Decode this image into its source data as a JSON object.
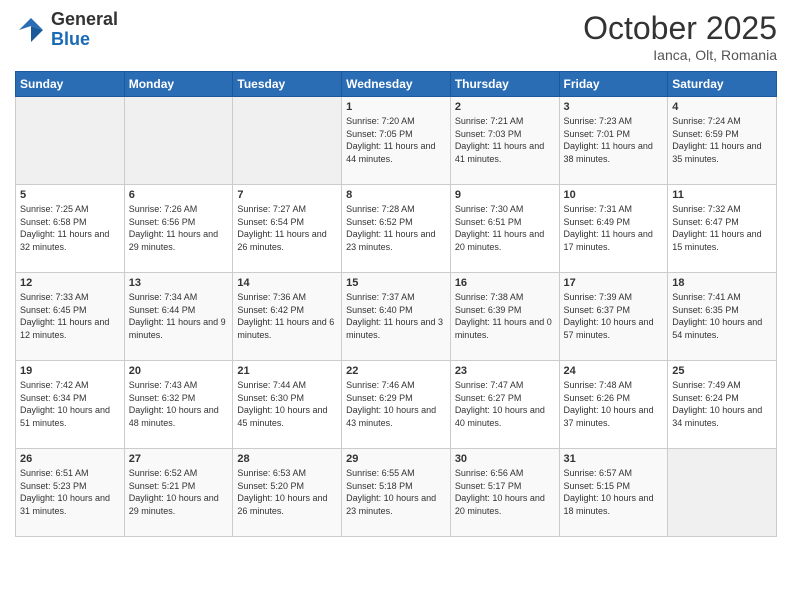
{
  "header": {
    "logo_general": "General",
    "logo_blue": "Blue",
    "month_title": "October 2025",
    "subtitle": "Ianca, Olt, Romania"
  },
  "weekdays": [
    "Sunday",
    "Monday",
    "Tuesday",
    "Wednesday",
    "Thursday",
    "Friday",
    "Saturday"
  ],
  "weeks": [
    [
      {
        "day": "",
        "info": ""
      },
      {
        "day": "",
        "info": ""
      },
      {
        "day": "",
        "info": ""
      },
      {
        "day": "1",
        "info": "Sunrise: 7:20 AM\nSunset: 7:05 PM\nDaylight: 11 hours and 44 minutes."
      },
      {
        "day": "2",
        "info": "Sunrise: 7:21 AM\nSunset: 7:03 PM\nDaylight: 11 hours and 41 minutes."
      },
      {
        "day": "3",
        "info": "Sunrise: 7:23 AM\nSunset: 7:01 PM\nDaylight: 11 hours and 38 minutes."
      },
      {
        "day": "4",
        "info": "Sunrise: 7:24 AM\nSunset: 6:59 PM\nDaylight: 11 hours and 35 minutes."
      }
    ],
    [
      {
        "day": "5",
        "info": "Sunrise: 7:25 AM\nSunset: 6:58 PM\nDaylight: 11 hours and 32 minutes."
      },
      {
        "day": "6",
        "info": "Sunrise: 7:26 AM\nSunset: 6:56 PM\nDaylight: 11 hours and 29 minutes."
      },
      {
        "day": "7",
        "info": "Sunrise: 7:27 AM\nSunset: 6:54 PM\nDaylight: 11 hours and 26 minutes."
      },
      {
        "day": "8",
        "info": "Sunrise: 7:28 AM\nSunset: 6:52 PM\nDaylight: 11 hours and 23 minutes."
      },
      {
        "day": "9",
        "info": "Sunrise: 7:30 AM\nSunset: 6:51 PM\nDaylight: 11 hours and 20 minutes."
      },
      {
        "day": "10",
        "info": "Sunrise: 7:31 AM\nSunset: 6:49 PM\nDaylight: 11 hours and 17 minutes."
      },
      {
        "day": "11",
        "info": "Sunrise: 7:32 AM\nSunset: 6:47 PM\nDaylight: 11 hours and 15 minutes."
      }
    ],
    [
      {
        "day": "12",
        "info": "Sunrise: 7:33 AM\nSunset: 6:45 PM\nDaylight: 11 hours and 12 minutes."
      },
      {
        "day": "13",
        "info": "Sunrise: 7:34 AM\nSunset: 6:44 PM\nDaylight: 11 hours and 9 minutes."
      },
      {
        "day": "14",
        "info": "Sunrise: 7:36 AM\nSunset: 6:42 PM\nDaylight: 11 hours and 6 minutes."
      },
      {
        "day": "15",
        "info": "Sunrise: 7:37 AM\nSunset: 6:40 PM\nDaylight: 11 hours and 3 minutes."
      },
      {
        "day": "16",
        "info": "Sunrise: 7:38 AM\nSunset: 6:39 PM\nDaylight: 11 hours and 0 minutes."
      },
      {
        "day": "17",
        "info": "Sunrise: 7:39 AM\nSunset: 6:37 PM\nDaylight: 10 hours and 57 minutes."
      },
      {
        "day": "18",
        "info": "Sunrise: 7:41 AM\nSunset: 6:35 PM\nDaylight: 10 hours and 54 minutes."
      }
    ],
    [
      {
        "day": "19",
        "info": "Sunrise: 7:42 AM\nSunset: 6:34 PM\nDaylight: 10 hours and 51 minutes."
      },
      {
        "day": "20",
        "info": "Sunrise: 7:43 AM\nSunset: 6:32 PM\nDaylight: 10 hours and 48 minutes."
      },
      {
        "day": "21",
        "info": "Sunrise: 7:44 AM\nSunset: 6:30 PM\nDaylight: 10 hours and 45 minutes."
      },
      {
        "day": "22",
        "info": "Sunrise: 7:46 AM\nSunset: 6:29 PM\nDaylight: 10 hours and 43 minutes."
      },
      {
        "day": "23",
        "info": "Sunrise: 7:47 AM\nSunset: 6:27 PM\nDaylight: 10 hours and 40 minutes."
      },
      {
        "day": "24",
        "info": "Sunrise: 7:48 AM\nSunset: 6:26 PM\nDaylight: 10 hours and 37 minutes."
      },
      {
        "day": "25",
        "info": "Sunrise: 7:49 AM\nSunset: 6:24 PM\nDaylight: 10 hours and 34 minutes."
      }
    ],
    [
      {
        "day": "26",
        "info": "Sunrise: 6:51 AM\nSunset: 5:23 PM\nDaylight: 10 hours and 31 minutes."
      },
      {
        "day": "27",
        "info": "Sunrise: 6:52 AM\nSunset: 5:21 PM\nDaylight: 10 hours and 29 minutes."
      },
      {
        "day": "28",
        "info": "Sunrise: 6:53 AM\nSunset: 5:20 PM\nDaylight: 10 hours and 26 minutes."
      },
      {
        "day": "29",
        "info": "Sunrise: 6:55 AM\nSunset: 5:18 PM\nDaylight: 10 hours and 23 minutes."
      },
      {
        "day": "30",
        "info": "Sunrise: 6:56 AM\nSunset: 5:17 PM\nDaylight: 10 hours and 20 minutes."
      },
      {
        "day": "31",
        "info": "Sunrise: 6:57 AM\nSunset: 5:15 PM\nDaylight: 10 hours and 18 minutes."
      },
      {
        "day": "",
        "info": ""
      }
    ]
  ]
}
